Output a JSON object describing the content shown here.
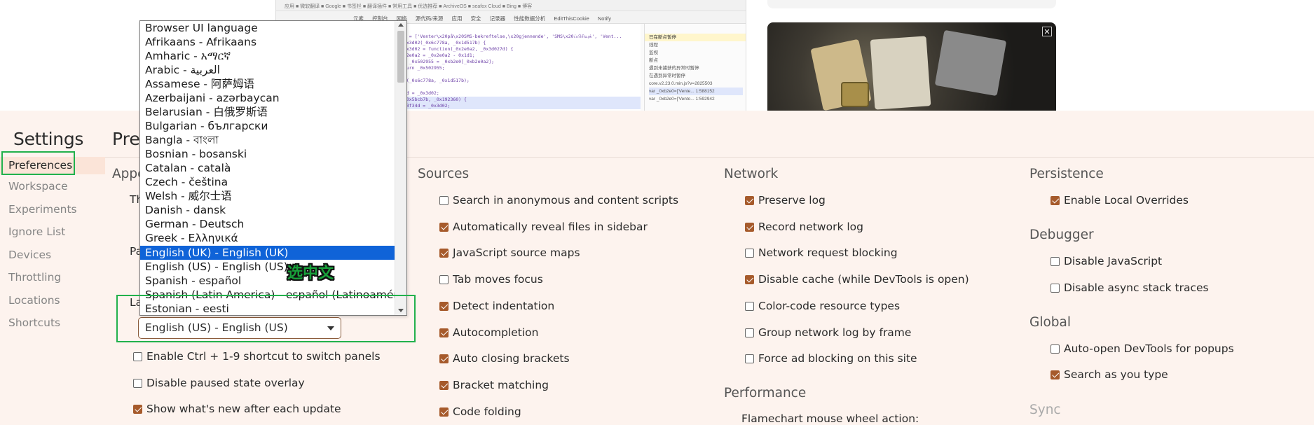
{
  "background": {
    "bookmarks_text": "应用  ■ 微软翻译  ■ Google  ■ 书签栏  ■ 翻译插件  ■ 常用工具  ■ 优选推荐  ■ ArchiveOS  ■ seafox Cloud  ■ Bing  ■ 博客",
    "devtools_tabs": [
      "元素",
      "控制台",
      "网络",
      "源代码/来源",
      "应用",
      "安全",
      "记录器",
      "性能数据分析",
      "EditThisCookie",
      "Notify"
    ],
    "code_lines": [
      "a0 = ['Venter\\x20på\\x20SMS-bekreftelse,\\x20gjennende', 'SMS\\x20ப்பிரிவுக்', 'Vent...",
      "_0x3d02(_0x6c778a, _0x1d517b) {",
      "_0x3d02 = function(_0x2e0a2, _0x3d027d) {",
      "0x2e0a2 = _0x2e0a2 - 0x1d1;",
      "ar _0x502955 = _0xb2e0[_0xb2e0a2];",
      "eturn _0x502955;",
      "",
      "02(_0x6c778a, _0x1d517b);",
      "",
      "33d = _0x3d02;",
      "(_0x5bcb7b, _0x192360) {",
      "a23f34d = _0x3d02;"
    ],
    "debug_panel": [
      "线程",
      "监视",
      "断点",
      "遇到未捕获的异常时暂停",
      "在遇到异常时暂停",
      "core.v2.23.0.min.js?v=2825503",
      "var _0xb2e0=['Vente... 1:588152",
      "var _0xb2e0=['Vento... 1:592942"
    ],
    "debug_paused": "已在断点暂停",
    "close_glyph": "✕"
  },
  "header": {
    "settings_title": "Settings",
    "page_title": "Pref"
  },
  "sidebar": {
    "items": [
      {
        "label": "Preferences",
        "active": true
      },
      {
        "label": "Workspace"
      },
      {
        "label": "Experiments"
      },
      {
        "label": "Ignore List"
      },
      {
        "label": "Devices"
      },
      {
        "label": "Throttling"
      },
      {
        "label": "Locations"
      },
      {
        "label": "Shortcuts"
      }
    ]
  },
  "appearance": {
    "heading_partial": "Appe",
    "theme_label_partial": "Th",
    "panel_label_partial": "Pa",
    "language_label_partial": "La",
    "language_selected": "English (US) - English (US)",
    "options": [
      {
        "label": "Enable Ctrl + 1-9 shortcut to switch panels",
        "checked": false
      },
      {
        "label": "Disable paused state overlay",
        "checked": false
      },
      {
        "label": "Show what's new after each update",
        "checked": true
      }
    ]
  },
  "language_dropdown": {
    "options": [
      "Browser UI language",
      "Afrikaans - Afrikaans",
      "Amharic - አማርኛ",
      "Arabic - العربية",
      "Assamese - 阿萨姆语",
      "Azerbaijani - azərbaycan",
      "Belarusian - 白俄罗斯语",
      "Bulgarian - български",
      "Bangla - বাংলা",
      "Bosnian - bosanski",
      "Catalan - català",
      "Czech - čeština",
      "Welsh - 威尔士语",
      "Danish - dansk",
      "German - Deutsch",
      "Greek - Ελληνικά",
      "English (UK) - English (UK)",
      "English (US) - English (US)",
      "Spanish - español",
      "Spanish (Latin America) - español (Latinoamérica)",
      "Estonian - eesti"
    ],
    "selected_index": 16
  },
  "sources": {
    "heading": "Sources",
    "options": [
      {
        "label": "Search in anonymous and content scripts",
        "checked": false
      },
      {
        "label": "Automatically reveal files in sidebar",
        "checked": true
      },
      {
        "label": "JavaScript source maps",
        "checked": true
      },
      {
        "label": "Tab moves focus",
        "checked": false
      },
      {
        "label": "Detect indentation",
        "checked": true
      },
      {
        "label": "Autocompletion",
        "checked": true
      },
      {
        "label": "Auto closing brackets",
        "checked": true
      },
      {
        "label": "Bracket matching",
        "checked": true
      },
      {
        "label": "Code folding",
        "checked": true
      }
    ]
  },
  "network": {
    "heading": "Network",
    "options": [
      {
        "label": "Preserve log",
        "checked": true
      },
      {
        "label": "Record network log",
        "checked": true
      },
      {
        "label": "Network request blocking",
        "checked": false
      },
      {
        "label": "Disable cache (while DevTools is open)",
        "checked": true
      },
      {
        "label": "Color-code resource types",
        "checked": false
      },
      {
        "label": "Group network log by frame",
        "checked": false
      },
      {
        "label": "Force ad blocking on this site",
        "checked": false
      }
    ]
  },
  "performance": {
    "heading": "Performance",
    "flamechart_label": "Flamechart mouse wheel action:"
  },
  "persistence": {
    "heading": "Persistence",
    "options": [
      {
        "label": "Enable Local Overrides",
        "checked": true
      }
    ]
  },
  "debugger": {
    "heading": "Debugger",
    "options": [
      {
        "label": "Disable JavaScript",
        "checked": false
      },
      {
        "label": "Disable async stack traces",
        "checked": false
      }
    ]
  },
  "global": {
    "heading": "Global",
    "options": [
      {
        "label": "Auto-open DevTools for popups",
        "checked": false
      },
      {
        "label": "Search as you type",
        "checked": true
      }
    ]
  },
  "sync": {
    "heading": "Sync"
  },
  "annotation": {
    "text": "选中文",
    "box_color": "#22b14c",
    "text_color": "#18a03a"
  },
  "colors": {
    "checkbox_checked": "#a65a2b",
    "selected_option": "#0f63d8",
    "page_background": "#fdf3ee"
  }
}
